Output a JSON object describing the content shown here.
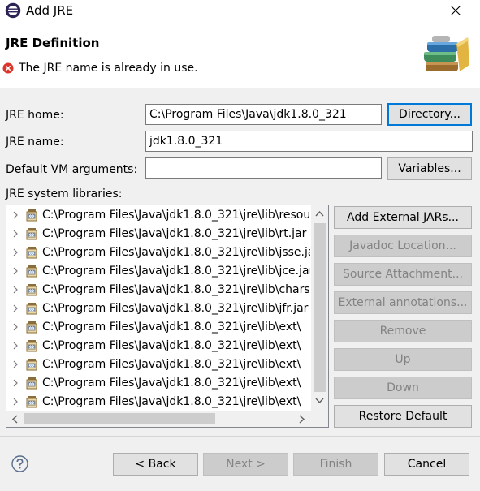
{
  "window": {
    "title": "Add JRE"
  },
  "header": {
    "title": "JRE Definition",
    "message": "The JRE name is already in use."
  },
  "form": {
    "jre_home_label": "JRE home:",
    "jre_home_value": "C:\\Program Files\\Java\\jdk1.8.0_321",
    "directory_button": "Directory...",
    "jre_name_label": "JRE name:",
    "jre_name_value": "jdk1.8.0_321",
    "vm_args_label": "Default VM arguments:",
    "vm_args_value": "",
    "variables_button": "Variables...",
    "libraries_label": "JRE system libraries:"
  },
  "libraries": [
    {
      "path": "C:\\Program Files\\Java\\jdk1.8.0_321\\jre\\lib\\resources.jar"
    },
    {
      "path": "C:\\Program Files\\Java\\jdk1.8.0_321\\jre\\lib\\rt.jar"
    },
    {
      "path": "C:\\Program Files\\Java\\jdk1.8.0_321\\jre\\lib\\jsse.jar"
    },
    {
      "path": "C:\\Program Files\\Java\\jdk1.8.0_321\\jre\\lib\\jce.jar"
    },
    {
      "path": "C:\\Program Files\\Java\\jdk1.8.0_321\\jre\\lib\\charsets.jar"
    },
    {
      "path": "C:\\Program Files\\Java\\jdk1.8.0_321\\jre\\lib\\jfr.jar"
    },
    {
      "path": "C:\\Program Files\\Java\\jdk1.8.0_321\\jre\\lib\\ext\\"
    },
    {
      "path": "C:\\Program Files\\Java\\jdk1.8.0_321\\jre\\lib\\ext\\"
    },
    {
      "path": "C:\\Program Files\\Java\\jdk1.8.0_321\\jre\\lib\\ext\\"
    },
    {
      "path": "C:\\Program Files\\Java\\jdk1.8.0_321\\jre\\lib\\ext\\"
    },
    {
      "path": "C:\\Program Files\\Java\\jdk1.8.0_321\\jre\\lib\\ext\\"
    }
  ],
  "side_buttons": {
    "add_external_jars": "Add External JARs...",
    "javadoc_location": "Javadoc Location...",
    "source_attachment": "Source Attachment...",
    "external_annotations": "External annotations...",
    "remove": "Remove",
    "up": "Up",
    "down": "Down",
    "restore_default": "Restore Default"
  },
  "footer": {
    "back": "< Back",
    "next": "Next >",
    "finish": "Finish",
    "cancel": "Cancel"
  },
  "colors": {
    "error": "#d9352b",
    "focus": "#0078d7",
    "disabled_bg": "#cccccc",
    "disabled_text": "#838383"
  },
  "icons": [
    "eclipse-icon",
    "maximize-icon",
    "close-icon",
    "error-icon",
    "library-books-icon",
    "chevron-right-icon",
    "jar-icon",
    "scroll-up-icon",
    "scroll-down-icon",
    "scroll-left-icon",
    "scroll-right-icon",
    "help-icon"
  ]
}
